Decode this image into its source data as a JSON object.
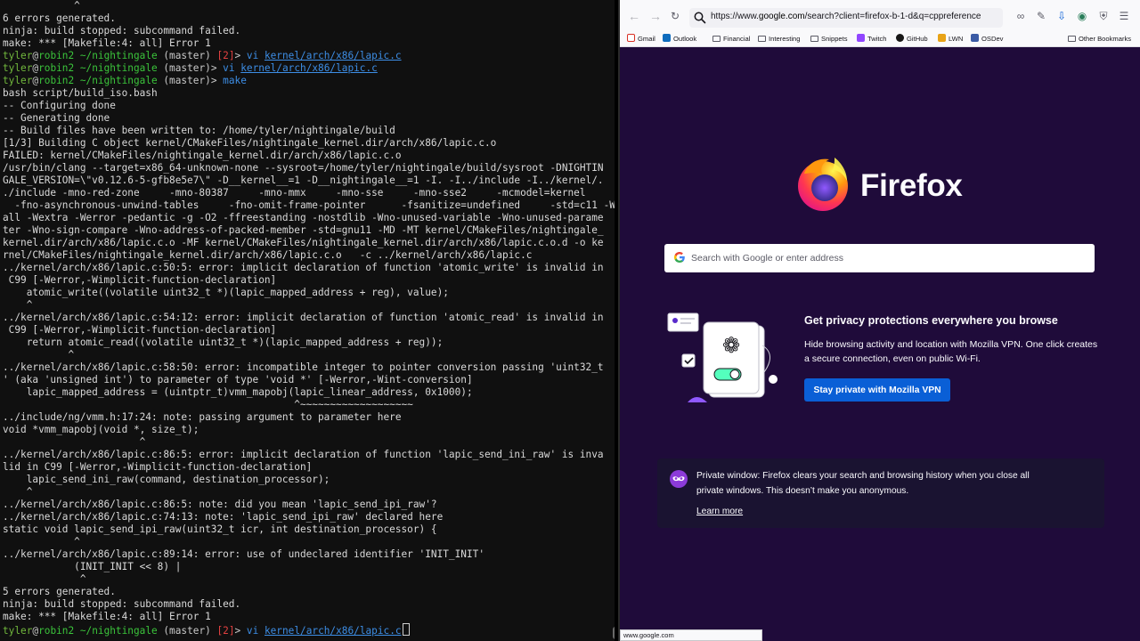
{
  "terminal": {
    "lines": [
      "            ^",
      "6 errors generated.",
      "ninja: build stopped: subcommand failed.",
      "make: *** [Makefile:4: all] Error 1",
      "/usr/bin/clang --target=x86_64-unknown-none --sysroot=/home/tyler/nightingale/build/sysroot -DNIGHTIN",
      "GALE_VERSION=\\\"v0.12.6-5-gfb8e5e7\\\" -D__kernel__=1 -D__nightingale__=1 -I. -I../include -I../kernel/.",
      "./include -mno-red-zone     -mno-80387     -mno-mmx     -mno-sse     -mno-sse2     -mcmodel=kernel",
      "  -fno-asynchronous-unwind-tables     -fno-omit-frame-pointer      -fsanitize=undefined     -std=c11 -W",
      "all -Wextra -Werror -pedantic -g -O2 -ffreestanding -nostdlib -Wno-unused-variable -Wno-unused-parame",
      "ter -Wno-sign-compare -Wno-address-of-packed-member -std=gnu11 -MD -MT kernel/CMakeFiles/nightingale_",
      "kernel.dir/arch/x86/lapic.c.o -MF kernel/CMakeFiles/nightingale_kernel.dir/arch/x86/lapic.c.o.d -o ke",
      "rnel/CMakeFiles/nightingale_kernel.dir/arch/x86/lapic.c.o   -c ../kernel/arch/x86/lapic.c",
      "../kernel/arch/x86/lapic.c:50:5: error: implicit declaration of function 'atomic_write' is invalid in",
      " C99 [-Werror,-Wimplicit-function-declaration]",
      "    atomic_write((volatile uint32_t *)(lapic_mapped_address + reg), value);",
      "    ^",
      "../kernel/arch/x86/lapic.c:54:12: error: implicit declaration of function 'atomic_read' is invalid in",
      " C99 [-Werror,-Wimplicit-function-declaration]",
      "    return atomic_read((volatile uint32_t *)(lapic_mapped_address + reg));",
      "           ^",
      "../kernel/arch/x86/lapic.c:58:50: error: incompatible integer to pointer conversion passing 'uint32_t",
      "' (aka 'unsigned int') to parameter of type 'void *' [-Werror,-Wint-conversion]",
      "    lapic_mapped_address = (uintptr_t)vmm_mapobj(lapic_linear_address, 0x1000);",
      "                                                 ^~~~~~~~~~~~~~~~~~~~",
      "../include/ng/vmm.h:17:24: note: passing argument to parameter here",
      "void *vmm_mapobj(void *, size_t);",
      "                       ^",
      "../kernel/arch/x86/lapic.c:86:5: error: implicit declaration of function 'lapic_send_ini_raw' is inva",
      "lid in C99 [-Werror,-Wimplicit-function-declaration]",
      "    lapic_send_ini_raw(command, destination_processor);",
      "    ^",
      "../kernel/arch/x86/lapic.c:86:5: note: did you mean 'lapic_send_ipi_raw'?",
      "../kernel/arch/x86/lapic.c:74:13: note: 'lapic_send_ipi_raw' declared here",
      "static void lapic_send_ipi_raw(uint32_t icr, int destination_processor) {",
      "            ^",
      "../kernel/arch/x86/lapic.c:89:14: error: use of undeclared identifier 'INIT_INIT'",
      "            (INIT_INIT << 8) |",
      "             ^",
      "5 errors generated.",
      "ninja: build stopped: subcommand failed.",
      "make: *** [Makefile:4: all] Error 1"
    ],
    "prompt": {
      "user": "tyler",
      "at": "@",
      "host": "robin2",
      "path": " ~/nightingale",
      "branch": " (master)",
      "status": "[2]",
      "gt": "> "
    },
    "cmd_vi": "vi",
    "file_lapic": "kernel/arch/x86/lapic.c",
    "cmd_make": "make",
    "build_lines": [
      "bash script/build_iso.bash",
      "-- Configuring done",
      "-- Generating done",
      "-- Build files have been written to: /home/tyler/nightingale/build",
      "[1/3] Building C object kernel/CMakeFiles/nightingale_kernel.dir/arch/x86/lapic.c.o",
      "FAILED: kernel/CMakeFiles/nightingale_kernel.dir/arch/x86/lapic.c.o"
    ]
  },
  "browser": {
    "url": "https://www.google.com/search?client=firefox-b-1-d&q=cppreference",
    "url_plain": "https://www.",
    "url_bold": "google.com",
    "url_rest": "/search?client=firefox-b-1-d&q=cppreference",
    "bookmarks": [
      {
        "label": "Gmail",
        "icon": "gmail-icon",
        "color": "#d93025"
      },
      {
        "label": "Outlook",
        "icon": "outlook-icon",
        "color": "#0f6cbd"
      },
      {
        "label": "Financial",
        "icon": "folder-icon"
      },
      {
        "label": "Interesting",
        "icon": "folder-icon"
      },
      {
        "label": "Snippets",
        "icon": "folder-icon"
      },
      {
        "label": "Twitch",
        "icon": "twitch-icon",
        "color": "#9146ff"
      },
      {
        "label": "GitHub",
        "icon": "github-icon",
        "color": "#181717"
      },
      {
        "label": "LWN",
        "icon": "lwn-icon",
        "color": "#e8a317"
      },
      {
        "label": "OSDev",
        "icon": "osdev-icon",
        "color": "#3b5ba5"
      }
    ],
    "other_bookmarks": "Other Bookmarks",
    "brand": "Firefox",
    "search_placeholder": "Search with Google or enter address",
    "promo": {
      "title": "Get privacy protections everywhere you browse",
      "body": "Hide browsing activity and location with Mozilla VPN. One click creates a secure connection, even on public Wi-Fi.",
      "button": "Stay private with Mozilla VPN"
    },
    "private_notice": "Private window: Firefox clears your search and browsing history when you close all private windows. This doesn’t make you anonymous.",
    "learn_more": "Learn more",
    "status_url": "www.google.com",
    "colors": {
      "background": "#1f0b3a",
      "button": "#0a5fd6",
      "terminal_bg": "#101010"
    }
  }
}
